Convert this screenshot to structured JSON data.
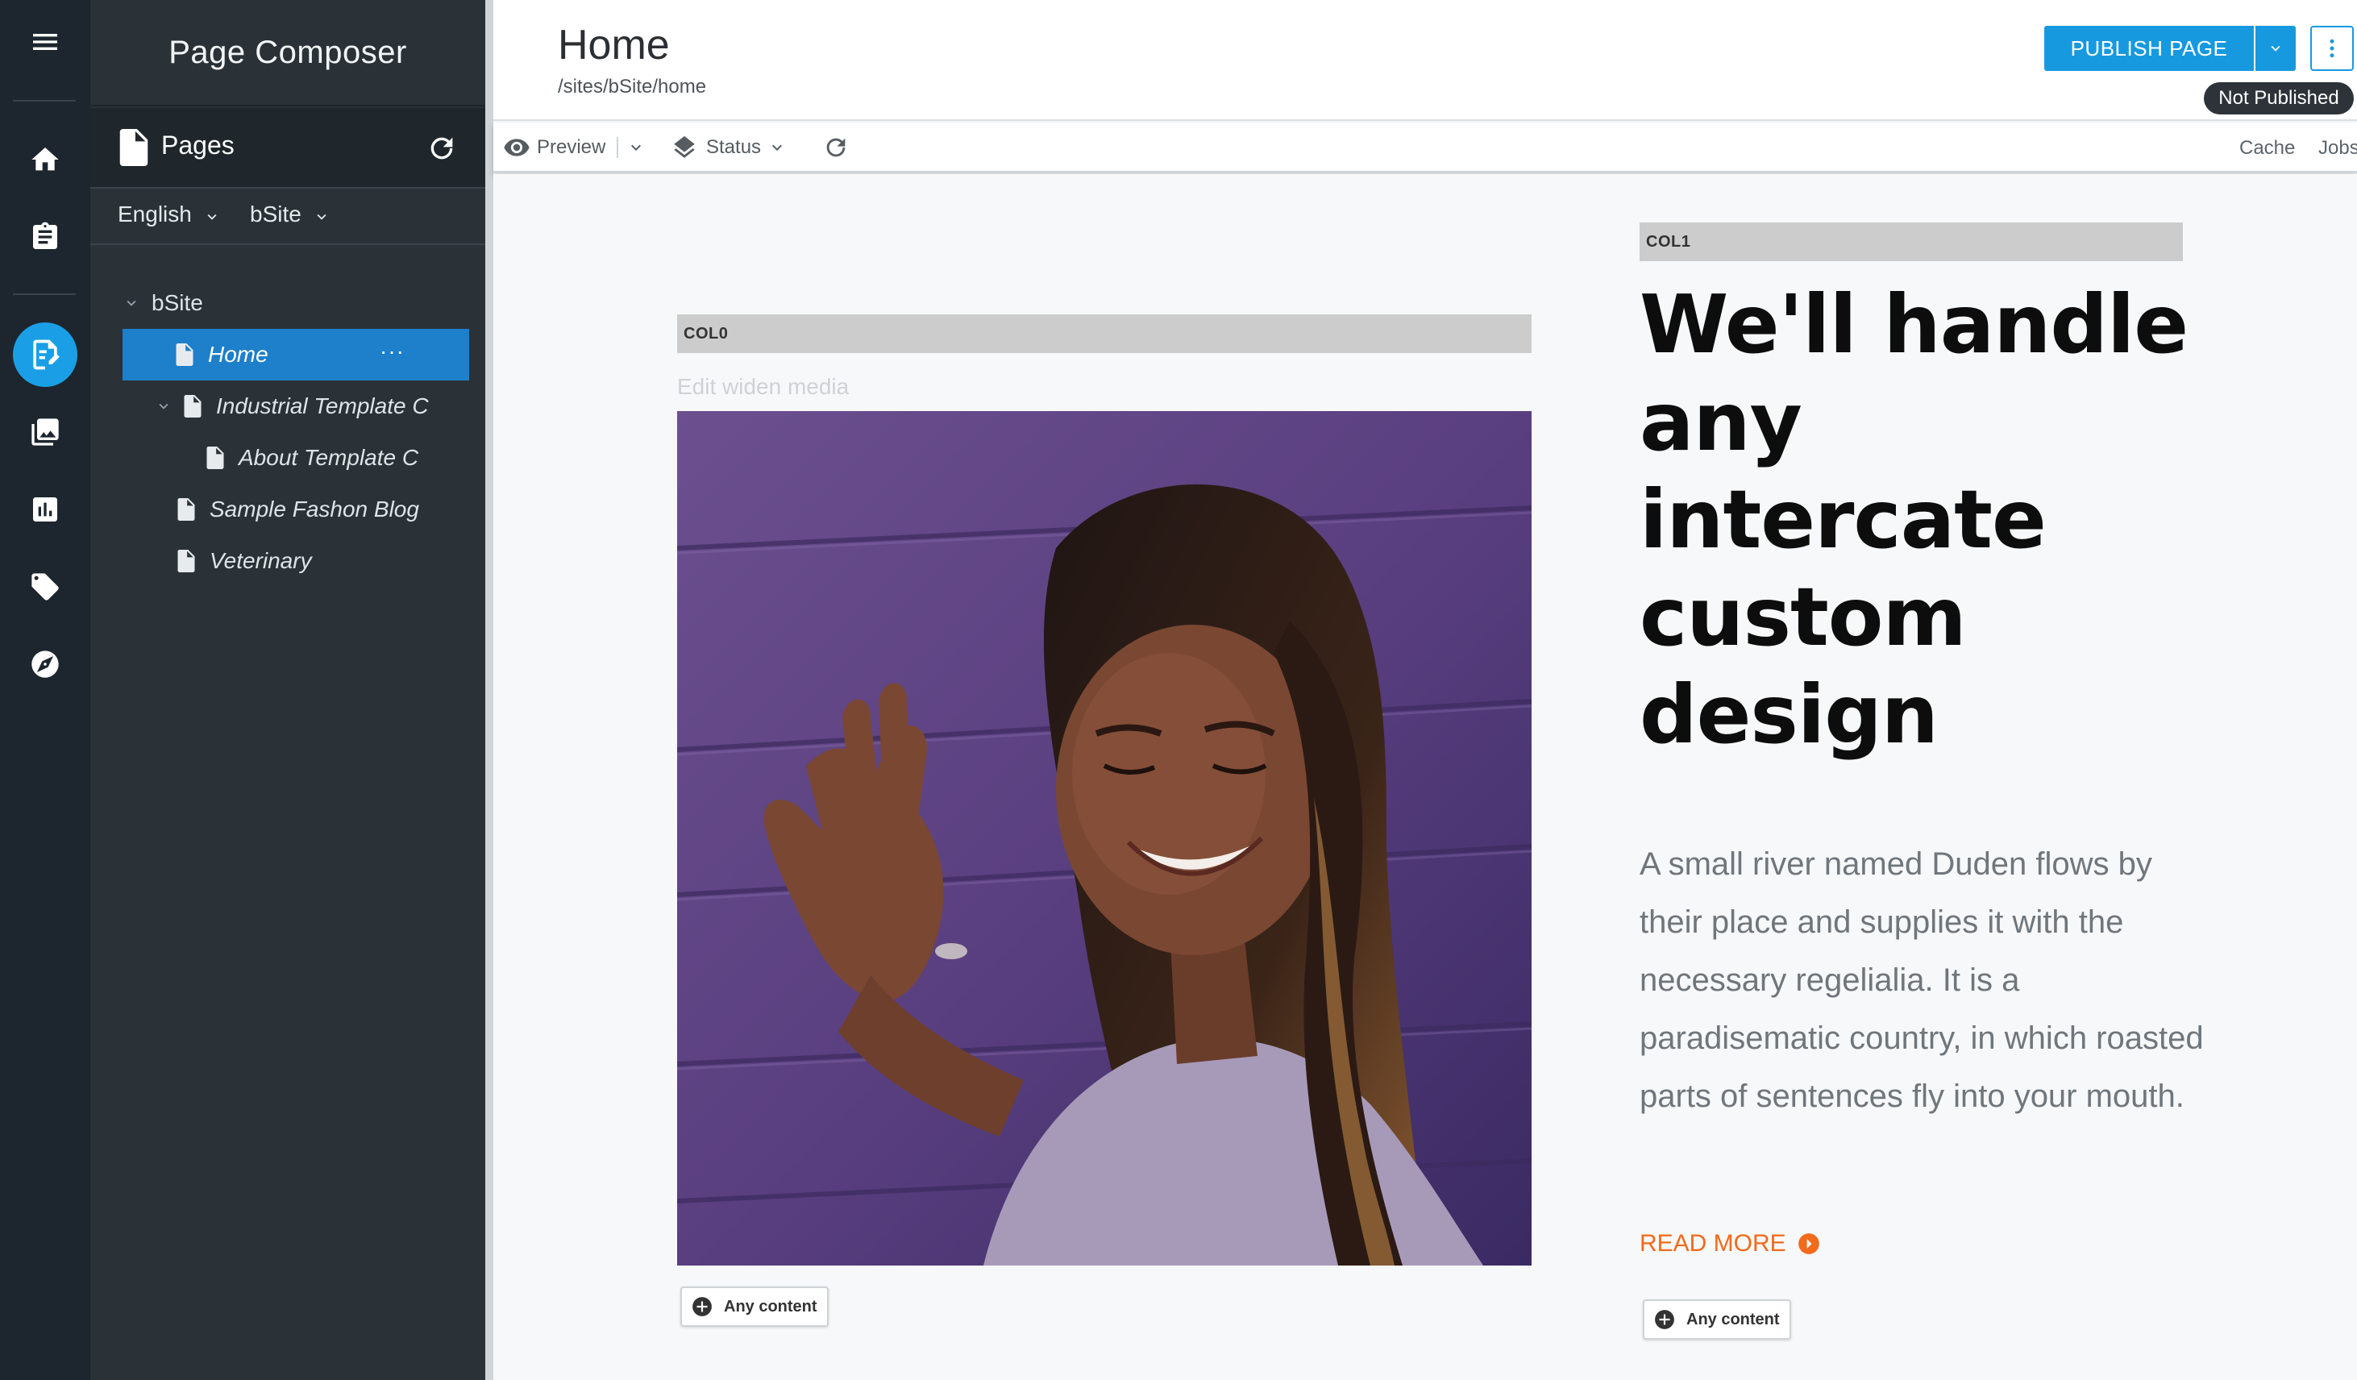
{
  "app": {
    "title": "Page Composer"
  },
  "rail": {
    "items": [
      "menu-icon",
      "home-icon",
      "clipboard-icon",
      "page-edit-icon",
      "images-icon",
      "analytics-icon",
      "tag-icon",
      "compass-icon"
    ],
    "active": "page-edit-icon",
    "active_color": "#1a9fe6"
  },
  "pages_panel": {
    "header": "Pages",
    "language": "English",
    "site": "bSite",
    "tree": [
      {
        "label": "bSite",
        "level": 0,
        "expanded": true
      },
      {
        "label": "Home",
        "level": 1,
        "selected": true,
        "more": "···"
      },
      {
        "label": "Industrial Template C",
        "level": 1,
        "expanded": true
      },
      {
        "label": "About Template C",
        "level": 2
      },
      {
        "label": "Sample Fashon Blog",
        "level": 1
      },
      {
        "label": "Veterinary",
        "level": 1
      }
    ],
    "selected_color": "#1e7fcb"
  },
  "header": {
    "title": "Home",
    "path": "/sites/bSite/home",
    "publish_label": "PUBLISH PAGE",
    "status": "Not Published",
    "accent": "#1799e0"
  },
  "toolbar": {
    "preview": "Preview",
    "status": "Status",
    "cache": "Cache",
    "jobs": "Jobs"
  },
  "canvas": {
    "col0": "COL0",
    "col1": "COL1",
    "edit_media": "Edit widen media",
    "headline": "We'll handle any intercate custom design",
    "body": "A small river named Duden flows by their place and supplies it with the necessary regelialia. It is a paradisematic country, in which roasted parts of sentences fly into your mouth.",
    "read_more": "READ MORE",
    "any_content": "Any content",
    "read_more_color": "#f26a1b"
  }
}
